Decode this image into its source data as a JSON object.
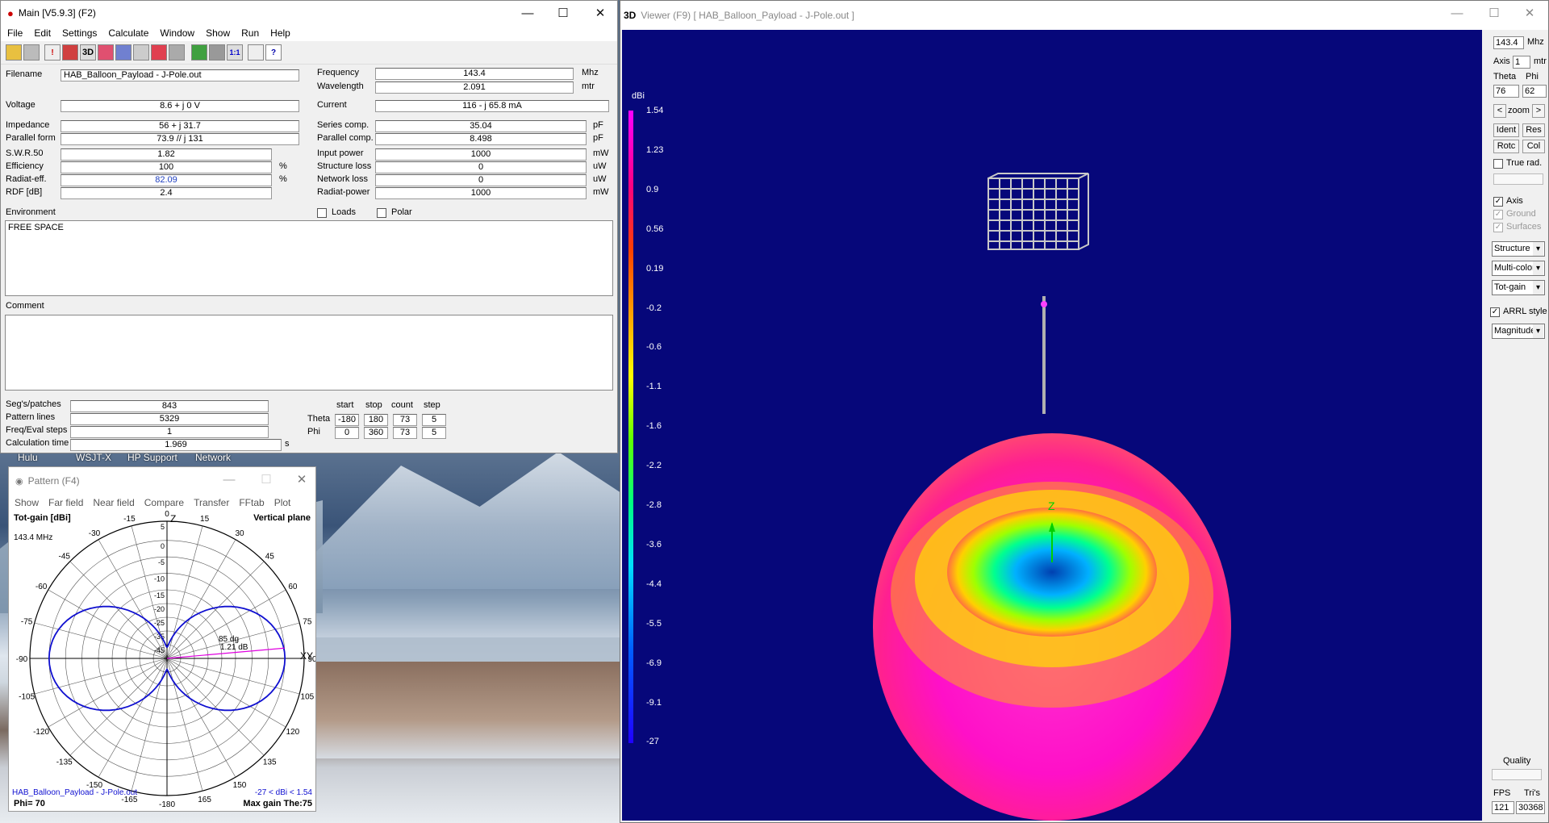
{
  "main": {
    "title": "Main [V5.9.3]  (F2)",
    "menu": [
      "File",
      "Edit",
      "Settings",
      "Calculate",
      "Window",
      "Show",
      "Run",
      "Help"
    ],
    "toolbar_icons": [
      "open-folder-icon",
      "copy-icon",
      "wire-icon",
      "nec-icon",
      "chart-icon",
      "3d-icon",
      "sphere-icon",
      "antenna-icon",
      "target-icon",
      "pattern-icon",
      "calc-icon",
      "table-icon",
      "ratio-icon",
      "book-icon",
      "help-icon"
    ],
    "toolbar_labels": {
      "3d": "3D",
      "ratio": "1:1"
    },
    "filename_label": "Filename",
    "filename": "HAB_Balloon_Payload - J-Pole.out",
    "frequency_label": "Frequency",
    "frequency": "143.4",
    "frequency_unit": "Mhz",
    "wavelength_label": "Wavelength",
    "wavelength": "2.091",
    "wavelength_unit": "mtr",
    "voltage_label": "Voltage",
    "voltage": "8.6 + j 0 V",
    "current_label": "Current",
    "current": "116 - j 65.8 mA",
    "impedance_label": "Impedance",
    "impedance": "56 + j 31.7",
    "parallel_form_label": "Parallel form",
    "parallel_form": "73.9 // j 131",
    "series_comp_label": "Series comp.",
    "series_comp": "35.04",
    "series_comp_unit": "pF",
    "parallel_comp_label": "Parallel comp.",
    "parallel_comp": "8.498",
    "parallel_comp_unit": "pF",
    "swr_label": "S.W.R.50",
    "swr": "1.82",
    "efficiency_label": "Efficiency",
    "efficiency": "100",
    "radiat_eff_label": "Radiat-eff.",
    "radiat_eff": "82.09",
    "rdf_label": "RDF [dB]",
    "rdf": "2.4",
    "pct": "%",
    "input_power_label": "Input power",
    "input_power": "1000",
    "structure_loss_label": "Structure loss",
    "structure_loss": "0",
    "network_loss_label": "Network loss",
    "network_loss": "0",
    "radiat_power_label": "Radiat-power",
    "radiat_power": "1000",
    "mw": "mW",
    "uw": "uW",
    "environment_label": "Environment",
    "loads_label": "Loads",
    "polar_label": "Polar",
    "environment": "FREE SPACE",
    "comment_label": "Comment",
    "comment": "",
    "segs_label": "Seg's/patches",
    "segs": "843",
    "pattern_lines_label": "Pattern lines",
    "pattern_lines": "5329",
    "freq_eval_label": "Freq/Eval steps",
    "freq_eval": "1",
    "calc_time_label": "Calculation time",
    "calc_time": "1.969",
    "calc_time_unit": "s",
    "grid_headers": [
      "start",
      "stop",
      "count",
      "step"
    ],
    "theta_label": "Theta",
    "theta": [
      "-180",
      "180",
      "73",
      "5"
    ],
    "phi_label": "Phi",
    "phi": [
      "0",
      "360",
      "73",
      "5"
    ]
  },
  "desktop_icons": [
    "Hulu",
    "WSJT-X",
    "HP Support",
    "Network"
  ],
  "pattern": {
    "title": "Pattern  (F4)",
    "menu": [
      "Show",
      "Far field",
      "Near field",
      "Compare",
      "Transfer",
      "FFtab",
      "Plot"
    ],
    "gain_title": "Tot-gain [dBi]",
    "plane": "Vertical plane",
    "freq": "143.4 MHz",
    "z_label": "Z",
    "xy_label": "XY",
    "angle_labels": [
      "0",
      "15",
      "30",
      "45",
      "60",
      "75",
      "90",
      "105",
      "120",
      "135",
      "150",
      "165",
      "-180",
      "-165",
      "-150",
      "-135",
      "-120",
      "-105",
      "-90",
      "-75",
      "-60",
      "-45",
      "-30",
      "-15"
    ],
    "ring_labels": [
      "5",
      "0",
      "-5",
      "-10",
      "-15",
      "-20",
      "-25",
      "-35",
      "-45"
    ],
    "marker_angle": "85 dg",
    "marker_gain": "1.21 dB",
    "file": "HAB_Balloon_Payload - J-Pole.out",
    "range": "-27 < dBi < 1.54",
    "phi": "Phi= 70",
    "max_gain": "Max gain The:75",
    "trace_color": "#1010d0"
  },
  "viewer": {
    "title_prefix": "3D",
    "title": "Viewer (F9)    [  HAB_Balloon_Payload - J-Pole.out ]",
    "scale_unit": "dBi",
    "scale_ticks": [
      "1.54",
      "1.23",
      "0.9",
      "0.56",
      "0.19",
      "-0.2",
      "-0.6",
      "-1.1",
      "-1.6",
      "-2.2",
      "-2.8",
      "-3.6",
      "-4.4",
      "-5.5",
      "-6.9",
      "-9.1",
      "-27"
    ],
    "freq": "143.4",
    "freq_unit": "Mhz",
    "axis_label": "Axis",
    "axis_value": "1",
    "axis_unit": "mtr",
    "theta_label": "Theta",
    "phi_label": "Phi",
    "theta": "76",
    "phi": "62",
    "zoom_label": "zoom",
    "ident": "Ident",
    "res": "Res",
    "rotc": "Rotc",
    "col": "Col",
    "true_rad": "True rad.",
    "axis_check": "Axis",
    "ground_check": "Ground",
    "surfaces_check": "Surfaces",
    "sel_structure": "Structure",
    "sel_color": "Multi-color",
    "sel_gain": "Tot-gain",
    "arrl": "ARRL style",
    "sel_mag": "Magnitude",
    "quality_label": "Quality",
    "fps_label": "FPS",
    "tris_label": "Tri's",
    "fps": "121",
    "tris": "30368",
    "background_color": "#06077a"
  }
}
